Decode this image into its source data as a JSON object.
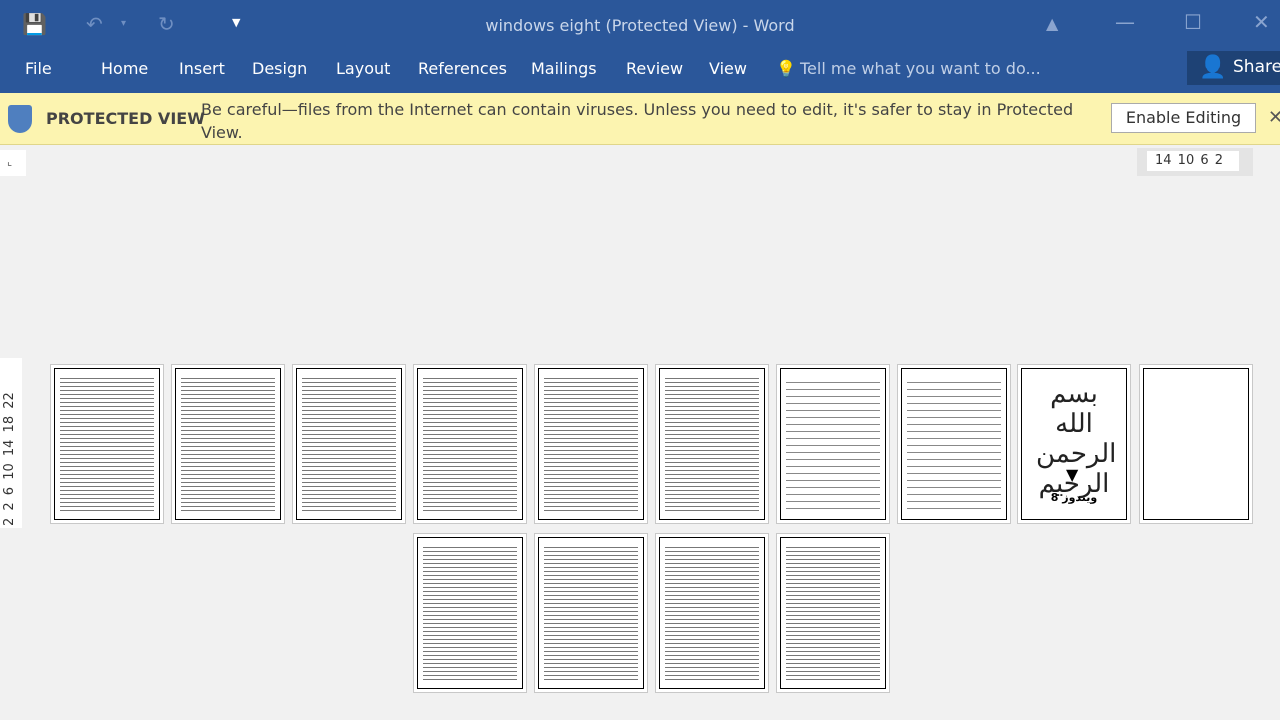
{
  "window": {
    "title": "windows eight (Protected View) - Word"
  },
  "quick_access": {
    "save": "save-icon",
    "undo": "undo-icon",
    "redo": "redo-icon",
    "customize": "customize-icon"
  },
  "ribbon": {
    "tabs": [
      "File",
      "Home",
      "Insert",
      "Design",
      "Layout",
      "References",
      "Mailings",
      "Review",
      "View"
    ],
    "tell_me": "Tell me what you want to do...",
    "share": "Share"
  },
  "protected_view": {
    "title": "PROTECTED VIEW",
    "message": "Be careful—files from the Internet can contain viruses. Unless you need to edit, it's safer to stay in Protected View.",
    "button": "Enable Editing"
  },
  "rulers": {
    "horizontal": "14 10 6 2",
    "vertical": "2 2 6 10 14 18 22"
  },
  "title_page": {
    "bismillah": "بسم الله الرحمن الرحيم",
    "title": "ویندوز 8"
  },
  "colors": {
    "ribbon": "#2b579a",
    "protected_bar": "#fcf4b0"
  }
}
